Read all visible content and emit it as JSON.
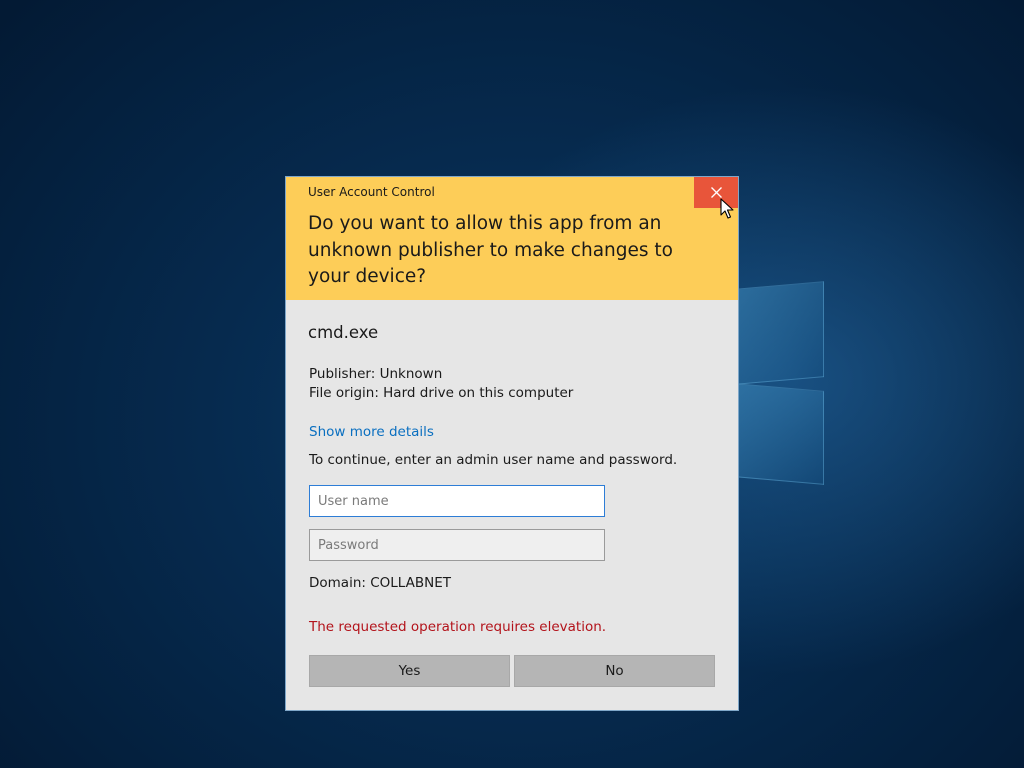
{
  "dialog": {
    "title": "User Account Control",
    "question": "Do you want to allow this app from an unknown publisher to make changes to your device?",
    "app_name": "cmd.exe",
    "publisher": "Publisher: Unknown",
    "file_origin": "File origin: Hard drive on this computer",
    "details_link": "Show more details",
    "continue_text": "To continue, enter an admin user name and password.",
    "username_placeholder": "User name",
    "username_value": "",
    "password_placeholder": "Password",
    "password_value": "",
    "domain": "Domain: COLLABNET",
    "error": "The requested operation requires elevation.",
    "yes_label": "Yes",
    "no_label": "No",
    "close_icon": "close-icon"
  },
  "colors": {
    "header_bg": "#fdcd58",
    "close_bg": "#e8553a",
    "link": "#0a6fc0",
    "error": "#b3131b",
    "dialog_bg": "#e6e6e6",
    "button_bg": "#b5b5b5",
    "focus_border": "#2d7dd6"
  },
  "desktop": {
    "logo_icon": "windows-logo-icon",
    "cursor_icon": "mouse-pointer-icon"
  }
}
